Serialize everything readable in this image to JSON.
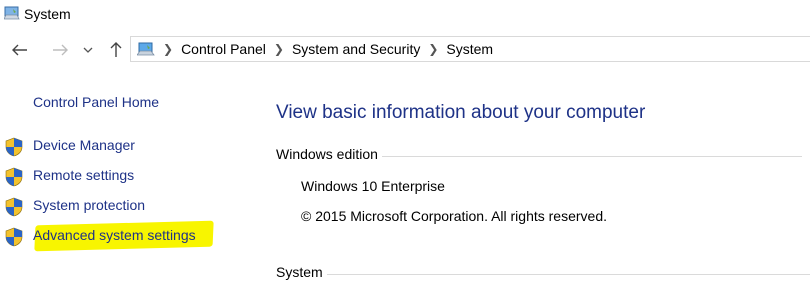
{
  "window": {
    "title": "System",
    "icon": "system-computer-icon"
  },
  "nav": {
    "back_icon": "back-arrow-icon",
    "forward_icon": "forward-arrow-icon",
    "recent_icon": "chevron-down-icon",
    "up_icon": "up-arrow-icon"
  },
  "address": {
    "icon": "control-panel-icon",
    "crumbs": [
      "Control Panel",
      "System and Security",
      "System"
    ]
  },
  "sidebar": {
    "home_label": "Control Panel Home",
    "items": [
      {
        "label": "Device Manager",
        "icon": "uac-shield-icon"
      },
      {
        "label": "Remote settings",
        "icon": "uac-shield-icon"
      },
      {
        "label": "System protection",
        "icon": "uac-shield-icon"
      },
      {
        "label": "Advanced system settings",
        "icon": "uac-shield-icon",
        "highlighted": true
      }
    ]
  },
  "main": {
    "heading": "View basic information about your computer",
    "windows_edition": {
      "header": "Windows edition",
      "edition": "Windows 10 Enterprise",
      "copyright": "© 2015 Microsoft Corporation. All rights reserved."
    },
    "system_header": "System"
  },
  "colors": {
    "link": "#1e3287",
    "highlight": "#f8f500",
    "rule": "#dadada",
    "shield_blue": "#2a64c5",
    "shield_yellow": "#f2c22e"
  }
}
